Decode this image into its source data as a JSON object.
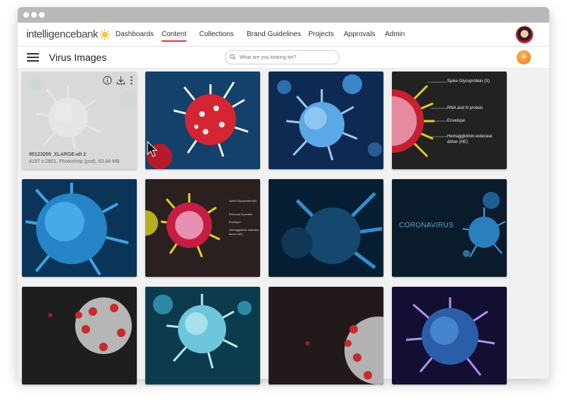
{
  "nav": {
    "logo": "intelligencebank",
    "items": [
      "Dashboards",
      "Content",
      "Collections",
      "Brand Guidelines",
      "Projects",
      "Approvals",
      "Admin"
    ],
    "active": "Content"
  },
  "page": {
    "title": "Virus Images",
    "search_placeholder": "What are you looking for?"
  },
  "hover_tile": {
    "name": "95123206_XLARGE-alt 2",
    "details": "4197 x 2801, Photoshop (psd), 83.84 MB"
  },
  "diagram_labels": {
    "large": [
      "Spike Glycoprotein (S)",
      "RNA and N protein",
      "Envelope",
      "Hemagglutinin-esterase",
      "dimer (HE)"
    ],
    "small": [
      "Spike Glycoprotein(S)",
      "RNA and N protein",
      "Envelope",
      "Hemagglutinin-esterase",
      "dimer (HE)"
    ]
  },
  "overlay_text": {
    "coronavirus": "CORONAVIRUS"
  },
  "icons": [
    "info-icon",
    "download-icon",
    "more-icon",
    "search-icon",
    "plus-icon",
    "hamburger-menu-icon",
    "cursor-icon"
  ],
  "colors": {
    "accent": "#e8303a",
    "add_button": "#f58a1f",
    "window_chrome": "#b9b9b9",
    "background": "#f1f1f1"
  }
}
